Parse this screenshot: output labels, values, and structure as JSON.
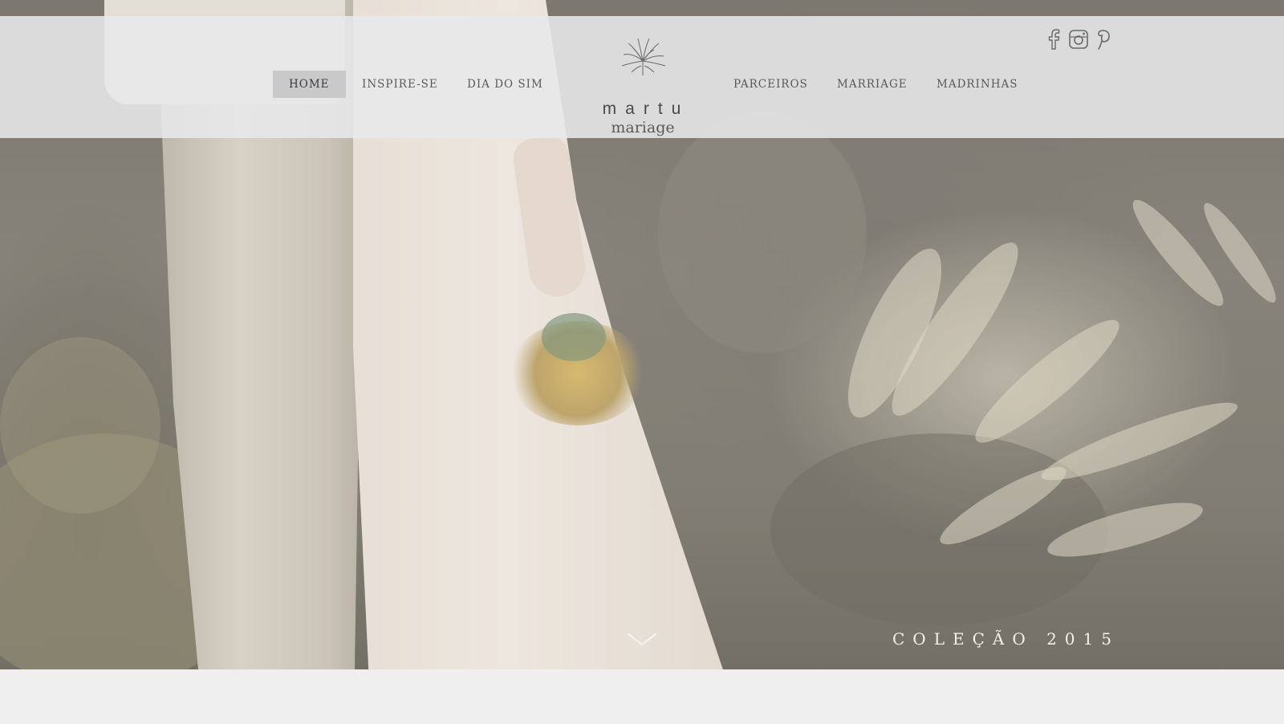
{
  "nav": {
    "left": [
      {
        "label": "HOME",
        "active": true
      },
      {
        "label": "INSPIRE-SE",
        "active": false
      },
      {
        "label": "DIA DO SIM",
        "active": false
      }
    ],
    "right": [
      {
        "label": "PARCEIROS",
        "active": false
      },
      {
        "label": "MARRIAGE",
        "active": false
      },
      {
        "label": "MADRINHAS",
        "active": false
      }
    ]
  },
  "logo": {
    "name": "martu",
    "subtitle": "mariage",
    "icon": "flower-bouquet-icon"
  },
  "social": {
    "icons": [
      "facebook-icon",
      "instagram-icon",
      "pinterest-icon"
    ]
  },
  "hero": {
    "collection_label": "COLEÇÃO 2015",
    "scroll_icon": "chevron-down-icon"
  },
  "colors": {
    "header_bg": "#e8e8ea",
    "active_nav_bg": "#c9c9cb",
    "nav_text": "#5a5a5a",
    "page_bg": "#efeff0",
    "hero_text": "#f2f0ea"
  }
}
